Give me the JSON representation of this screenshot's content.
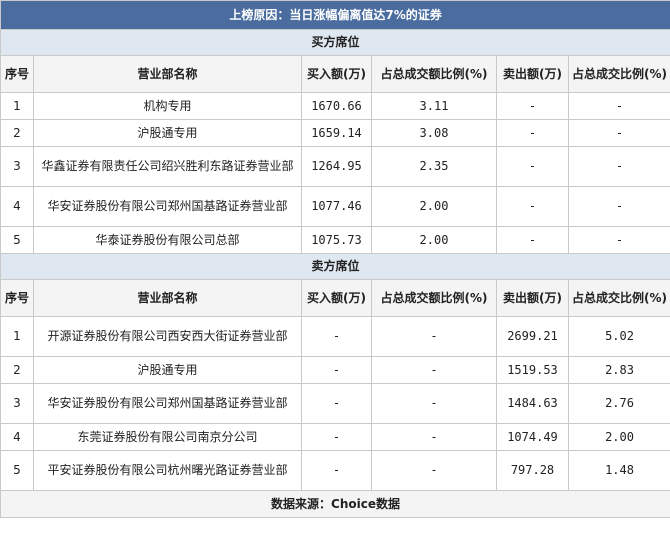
{
  "title": "上榜原因：当日涨幅偏离值达7%的证券",
  "columns": {
    "seq": "序号",
    "name": "营业部名称",
    "buy": "买入额(万)",
    "buy_pct": "占总成交额比例(%)",
    "sell": "卖出额(万)",
    "sell_pct": "占总成交比例(%)"
  },
  "buy_section": {
    "label": "买方席位",
    "rows": [
      {
        "seq": "1",
        "name": "机构专用",
        "buy": "1670.66",
        "buy_pct": "3.11",
        "sell": "-",
        "sell_pct": "-"
      },
      {
        "seq": "2",
        "name": "沪股通专用",
        "buy": "1659.14",
        "buy_pct": "3.08",
        "sell": "-",
        "sell_pct": "-"
      },
      {
        "seq": "3",
        "name": "华鑫证券有限责任公司绍兴胜利东路证券营业部",
        "buy": "1264.95",
        "buy_pct": "2.35",
        "sell": "-",
        "sell_pct": "-"
      },
      {
        "seq": "4",
        "name": "华安证券股份有限公司郑州国基路证券营业部",
        "buy": "1077.46",
        "buy_pct": "2.00",
        "sell": "-",
        "sell_pct": "-"
      },
      {
        "seq": "5",
        "name": "华泰证券股份有限公司总部",
        "buy": "1075.73",
        "buy_pct": "2.00",
        "sell": "-",
        "sell_pct": "-"
      }
    ]
  },
  "sell_section": {
    "label": "卖方席位",
    "rows": [
      {
        "seq": "1",
        "name": "开源证券股份有限公司西安西大街证券营业部",
        "buy": "-",
        "buy_pct": "-",
        "sell": "2699.21",
        "sell_pct": "5.02"
      },
      {
        "seq": "2",
        "name": "沪股通专用",
        "buy": "-",
        "buy_pct": "-",
        "sell": "1519.53",
        "sell_pct": "2.83"
      },
      {
        "seq": "3",
        "name": "华安证券股份有限公司郑州国基路证券营业部",
        "buy": "-",
        "buy_pct": "-",
        "sell": "1484.63",
        "sell_pct": "2.76"
      },
      {
        "seq": "4",
        "name": "东莞证券股份有限公司南京分公司",
        "buy": "-",
        "buy_pct": "-",
        "sell": "1074.49",
        "sell_pct": "2.00"
      },
      {
        "seq": "5",
        "name": "平安证券股份有限公司杭州曙光路证券营业部",
        "buy": "-",
        "buy_pct": "-",
        "sell": "797.28",
        "sell_pct": "1.48"
      }
    ]
  },
  "footer": "数据来源：Choice数据"
}
